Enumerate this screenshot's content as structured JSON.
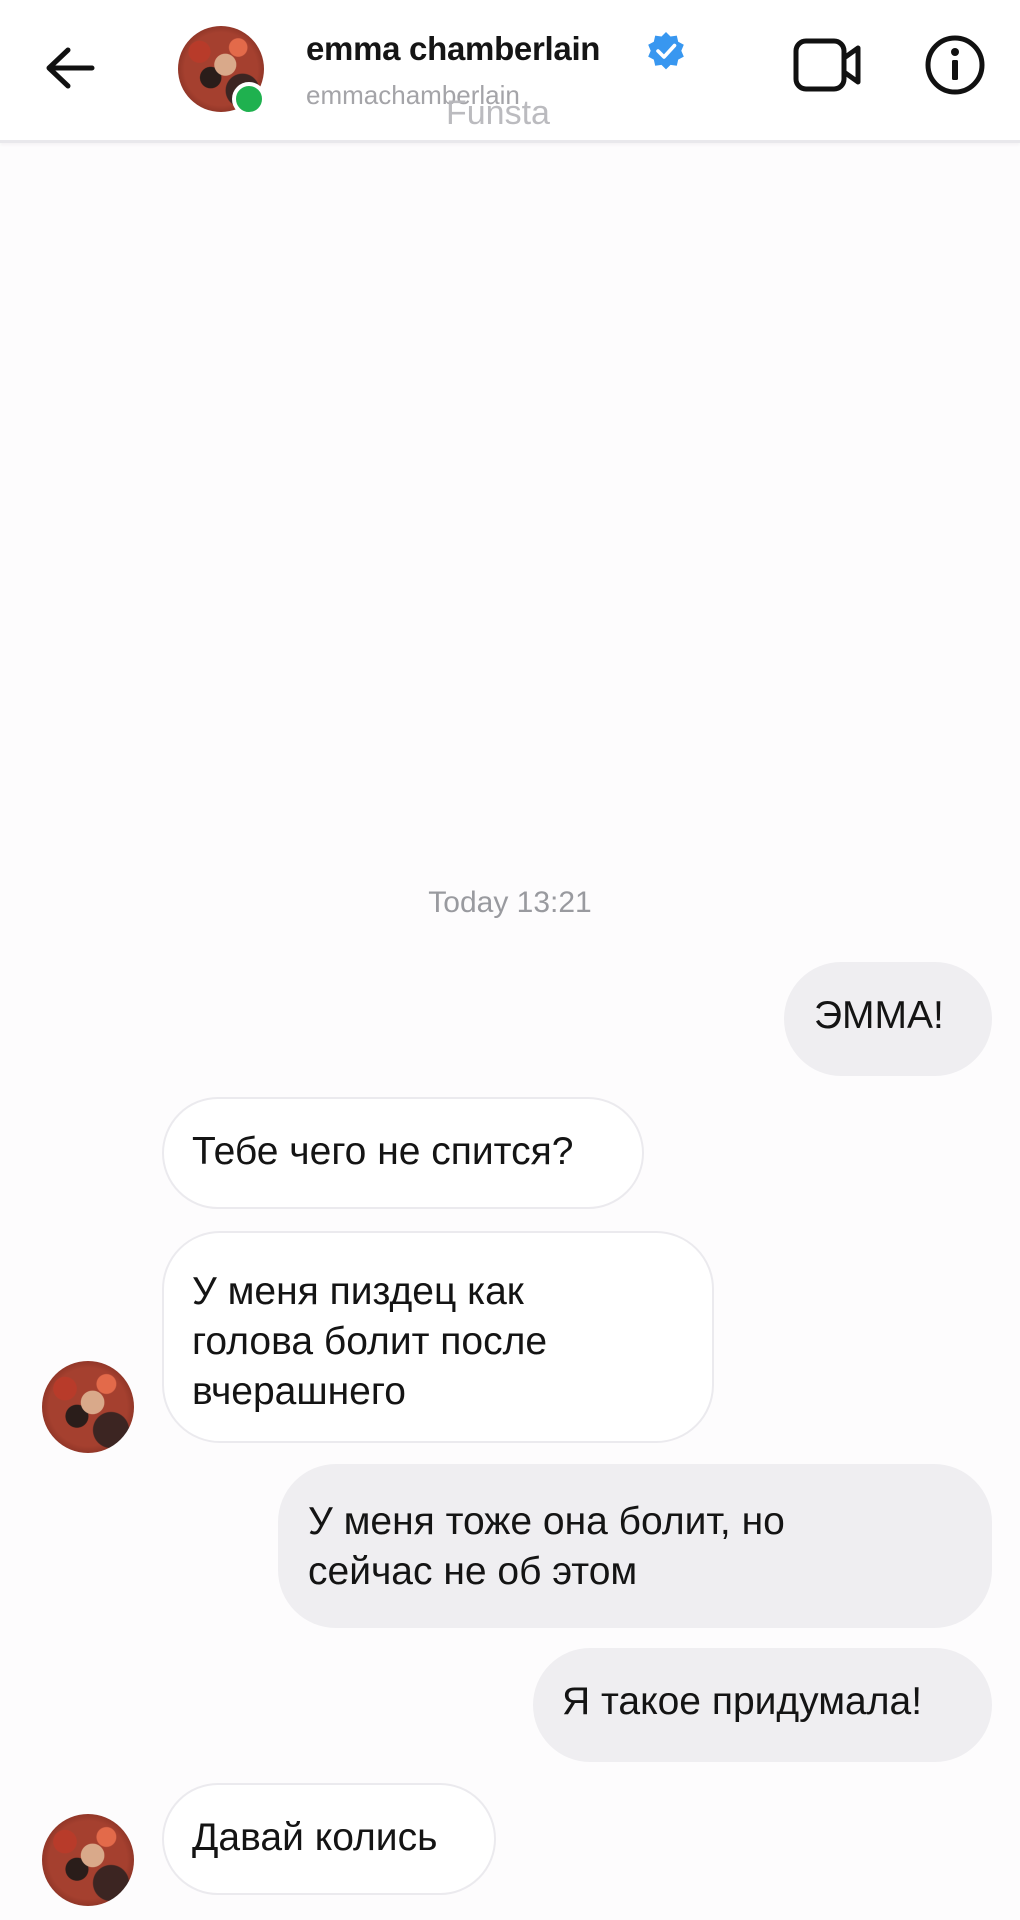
{
  "header": {
    "contact_name": "emma chamberlain",
    "username": "emmachamberlain",
    "watermark": "Funsta",
    "online": true,
    "verified": true,
    "icons": {
      "back": "arrow-left-icon",
      "video": "video-camera-icon",
      "info": "info-circle-icon",
      "verified": "verified-badge-icon"
    }
  },
  "thread": {
    "timestamp": "Today 13:21",
    "messages": [
      {
        "direction": "outgoing",
        "lines": [
          "ЭММА!"
        ]
      },
      {
        "direction": "incoming",
        "lines": [
          "Тебе чего не спится?"
        ]
      },
      {
        "direction": "incoming",
        "lines": [
          "У меня пиздец как",
          "голова болит после",
          "вчерашнего"
        ],
        "show_avatar": true
      },
      {
        "direction": "outgoing",
        "lines": [
          "У меня тоже она болит, но",
          "сейчас не об этом"
        ]
      },
      {
        "direction": "outgoing",
        "lines": [
          "Я такое придумала!"
        ]
      },
      {
        "direction": "incoming",
        "lines": [
          "Давай колись"
        ],
        "show_avatar": true
      }
    ]
  },
  "colors": {
    "outgoing_bubble": "#efeef1",
    "incoming_bubble": "#ffffff",
    "online_dot": "#1fb14f",
    "verified_badge": "#3897f0",
    "timestamp": "#999a9f"
  }
}
